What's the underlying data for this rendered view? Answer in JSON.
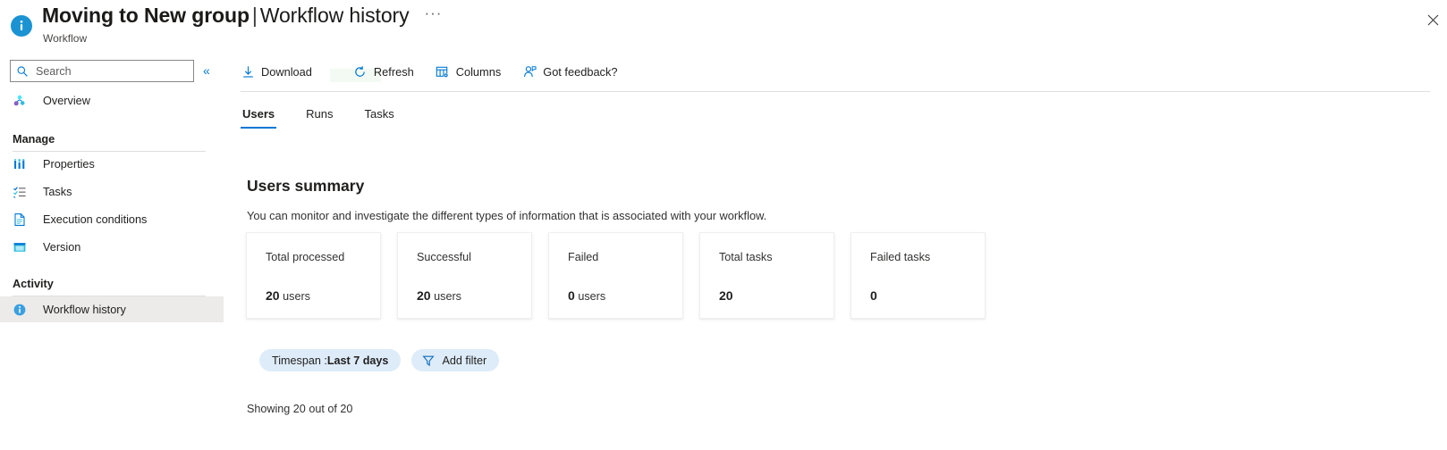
{
  "titlebar": {
    "icon": "info-circle-icon",
    "title_main": "Moving to New group",
    "title_separator": "|",
    "title_section": "Workflow history",
    "more_label": "···",
    "subtitle": "Workflow",
    "close_label": "✕"
  },
  "sidebar": {
    "search": {
      "placeholder": "Search",
      "value": ""
    },
    "collapse_label": "«",
    "overview": {
      "label": "Overview",
      "icon": "overview-resource-icon"
    },
    "groups": [
      {
        "label": "Manage",
        "items": [
          {
            "label": "Properties",
            "icon": "properties-bars-icon"
          },
          {
            "label": "Tasks",
            "icon": "tasks-checklist-icon"
          },
          {
            "label": "Execution conditions",
            "icon": "document-icon"
          },
          {
            "label": "Version",
            "icon": "version-window-icon"
          }
        ]
      },
      {
        "label": "Activity",
        "items": [
          {
            "label": "Workflow history",
            "icon": "info-circle-icon",
            "selected": true
          }
        ]
      }
    ]
  },
  "main": {
    "commands": [
      {
        "label": "Download",
        "icon": "download-arrow-icon"
      },
      {
        "label": "Refresh",
        "icon": "refresh-circular-icon"
      },
      {
        "label": "Columns",
        "icon": "columns-table-icon"
      },
      {
        "label": "Got feedback?",
        "icon": "feedback-person-icon"
      }
    ],
    "tabs": [
      {
        "label": "Users",
        "active": true
      },
      {
        "label": "Runs",
        "active": false
      },
      {
        "label": "Tasks",
        "active": false
      }
    ],
    "summary": {
      "heading": "Users summary",
      "description": "You can monitor and investigate the different types of information that is associated with your workflow."
    },
    "cards": [
      {
        "label": "Total processed",
        "value": "20",
        "unit": "users"
      },
      {
        "label": "Successful",
        "value": "20",
        "unit": "users"
      },
      {
        "label": "Failed",
        "value": "0",
        "unit": "users"
      },
      {
        "label": "Total tasks",
        "value": "20",
        "unit": ""
      },
      {
        "label": "Failed tasks",
        "value": "0",
        "unit": ""
      }
    ],
    "filters": {
      "timespan_prefix": "Timespan : ",
      "timespan_value": "Last 7 days",
      "add_filter_label": "Add filter",
      "add_filter_icon": "funnel-filter-icon"
    },
    "showing_count": "Showing 20 out of 20"
  },
  "colors": {
    "accent": "#0078d4",
    "info_blue": "#1b93d3",
    "pill_bg": "#deecf9",
    "selected_nav_bg": "#edebe9",
    "divider": "#e1dfdd",
    "download_highlight": "#f3faf3"
  }
}
